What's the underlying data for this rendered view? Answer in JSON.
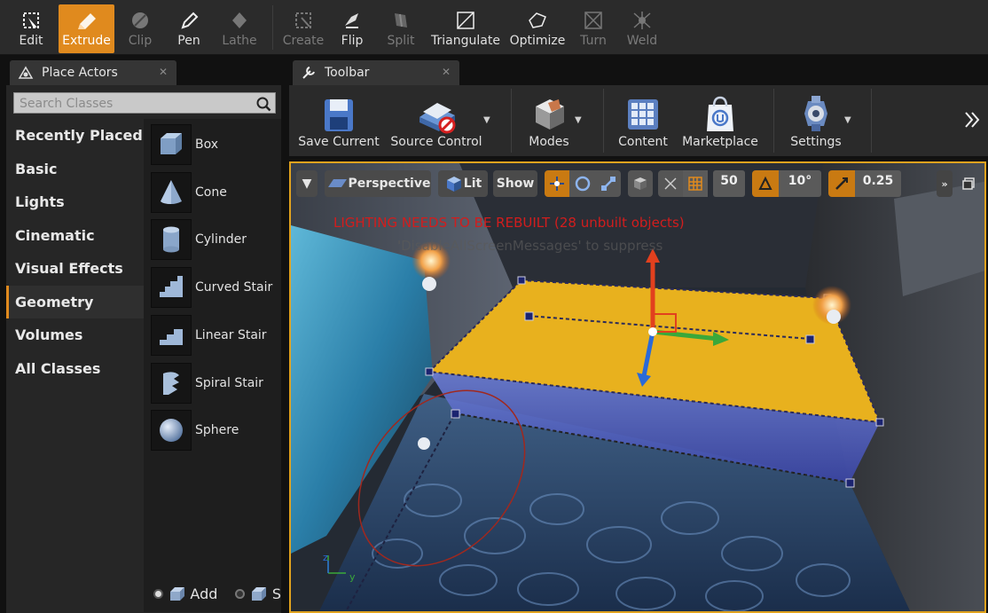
{
  "geometry_tools": [
    {
      "label": "Edit",
      "icon": "edit-icon",
      "state": "normal"
    },
    {
      "label": "Extrude",
      "icon": "extrude-icon",
      "state": "active"
    },
    {
      "label": "Clip",
      "icon": "clip-icon",
      "state": "disabled"
    },
    {
      "label": "Pen",
      "icon": "pen-icon",
      "state": "normal"
    },
    {
      "label": "Lathe",
      "icon": "lathe-icon",
      "state": "disabled"
    },
    {
      "label": "Create",
      "icon": "create-icon",
      "state": "disabled"
    },
    {
      "label": "Flip",
      "icon": "flip-icon",
      "state": "normal"
    },
    {
      "label": "Split",
      "icon": "split-icon",
      "state": "disabled"
    },
    {
      "label": "Triangulate",
      "icon": "triangulate-icon",
      "state": "normal"
    },
    {
      "label": "Optimize",
      "icon": "optimize-icon",
      "state": "normal"
    },
    {
      "label": "Turn",
      "icon": "turn-icon",
      "state": "disabled"
    },
    {
      "label": "Weld",
      "icon": "weld-icon",
      "state": "disabled"
    }
  ],
  "tabs": {
    "place_actors": "Place Actors",
    "toolbar": "Toolbar"
  },
  "search": {
    "placeholder": "Search Classes"
  },
  "categories": [
    "Recently Placed",
    "Basic",
    "Lights",
    "Cinematic",
    "Visual Effects",
    "Geometry",
    "Volumes",
    "All Classes"
  ],
  "selected_category": "Geometry",
  "actors": [
    "Box",
    "Cone",
    "Cylinder",
    "Curved Stair",
    "Linear Stair",
    "Spiral Stair",
    "Sphere"
  ],
  "brush_mode": {
    "add_label": "Add",
    "subtract_label": "S"
  },
  "toolbar_buttons": [
    {
      "label": "Save Current",
      "icon": "save-icon"
    },
    {
      "label": "Source Control",
      "icon": "source-control-icon"
    },
    {
      "label": "Modes",
      "icon": "modes-icon"
    },
    {
      "label": "Content",
      "icon": "content-icon"
    },
    {
      "label": "Marketplace",
      "icon": "marketplace-icon"
    },
    {
      "label": "Settings",
      "icon": "settings-icon"
    }
  ],
  "viewport": {
    "view_mode": "Perspective",
    "lighting_mode": "Lit",
    "show_label": "Show",
    "grid_snap": "50",
    "rotation_snap": "10°",
    "scale_snap": "0.25",
    "warning": "LIGHTING NEEDS TO BE REBUILT (28 unbuilt objects)",
    "warning_sub": "'DisableAllScreenMessages' to suppress"
  },
  "colors": {
    "accent": "#e08a1e",
    "warning": "#d21d1d",
    "brush_yellow": "#e8b11e"
  }
}
